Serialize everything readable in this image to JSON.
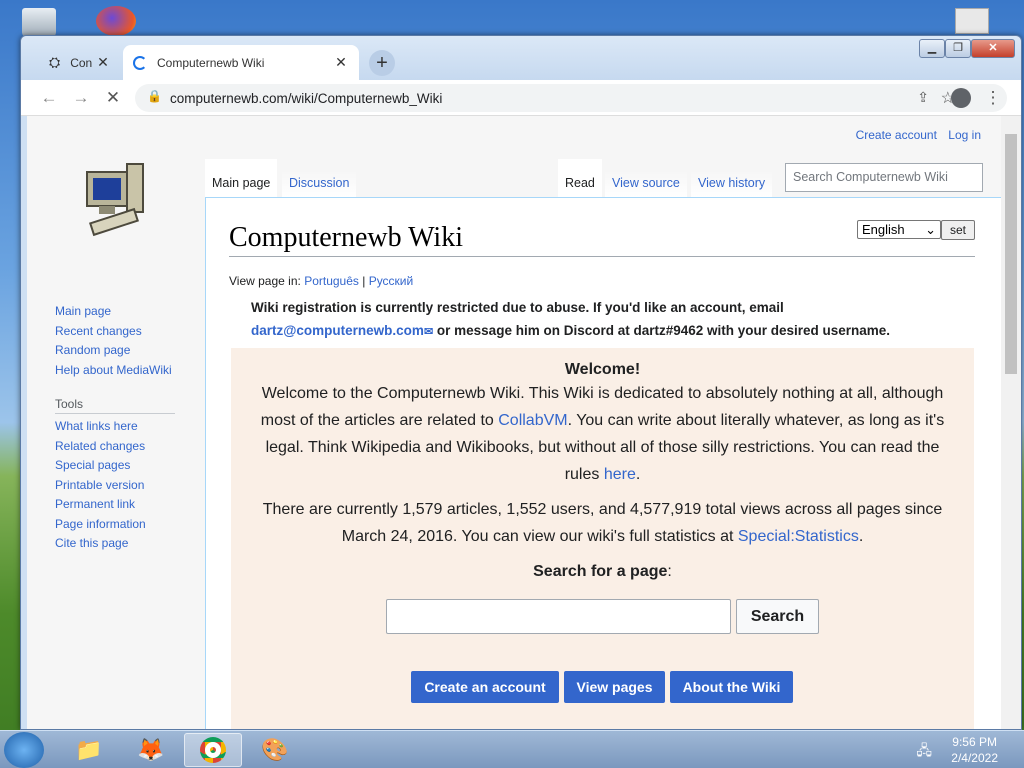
{
  "browser": {
    "tabs": [
      {
        "title": "Con",
        "active": false
      },
      {
        "title": "Computernewb Wiki",
        "active": true
      }
    ],
    "url": "computernewb.com/wiki/Computernewb_Wiki"
  },
  "wiki": {
    "personal": {
      "create_account": "Create account",
      "login": "Log in"
    },
    "nav": [
      "Main page",
      "Recent changes",
      "Random page",
      "Help about MediaWiki"
    ],
    "tools_header": "Tools",
    "tools": [
      "What links here",
      "Related changes",
      "Special pages",
      "Printable version",
      "Permanent link",
      "Page information",
      "Cite this page"
    ],
    "tabs": {
      "main": "Main page",
      "discussion": "Discussion",
      "read": "Read",
      "view_source": "View source",
      "view_history": "View history"
    },
    "search_placeholder": "Search Computernewb Wiki",
    "title": "Computernewb Wiki",
    "language": "English",
    "set_label": "set",
    "view_in_label": "View page in:",
    "view_in_langs": [
      "Português",
      "Русский"
    ],
    "notice_a": "Wiki registration is currently restricted due to abuse. If you'd like an account, email",
    "notice_email": "dartz@computernewb.com",
    "notice_b": " or message him on Discord at dartz#9462 with your desired username.",
    "welcome": {
      "heading": "Welcome!",
      "p1_a": "Welcome to the Computernewb Wiki. This Wiki is dedicated to absolutely nothing at all, although most of the articles are related to ",
      "p1_link": "CollabVM",
      "p1_b": ". You can write about literally whatever, as long as it's legal. Think Wikipedia and Wikibooks, but without all of those silly restrictions. You can read the rules ",
      "p1_link2": "here",
      "p1_c": ".",
      "p2_a": "There are currently 1,579 articles, 1,552 users, and 4,577,919 total views across all pages since March 24, 2016. You can view our wiki's full statistics at ",
      "p2_link": "Special:Statistics",
      "p2_b": ".",
      "search_heading": "Search for a page",
      "search_btn": "Search",
      "btn_create": "Create an account",
      "btn_view": "View pages",
      "btn_about": "About the Wiki"
    }
  },
  "taskbar": {
    "time": "9:56 PM",
    "date": "2/4/2022"
  }
}
